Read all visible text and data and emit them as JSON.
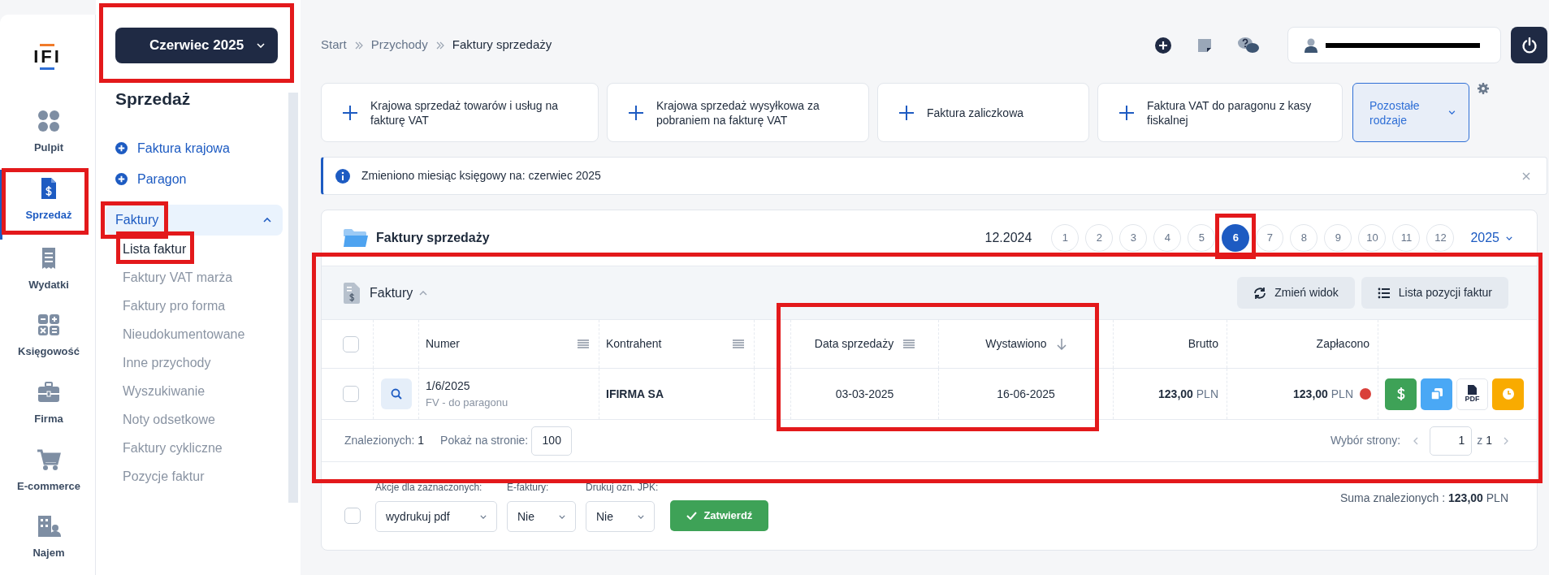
{
  "logo": {
    "text": "IFI"
  },
  "nav_rail": [
    {
      "label": "Pulpit",
      "kind": "dots",
      "selected": false,
      "highlighted": false
    },
    {
      "label": "Sprzedaż",
      "kind": "invoice",
      "selected": true,
      "highlighted": true
    },
    {
      "label": "Wydatki",
      "kind": "receipt",
      "selected": false,
      "highlighted": false
    },
    {
      "label": "Księgowość",
      "kind": "calc",
      "selected": false,
      "highlighted": false
    },
    {
      "label": "Firma",
      "kind": "briefcase",
      "selected": false,
      "highlighted": false
    },
    {
      "label": "E-commerce",
      "kind": "cart",
      "selected": false,
      "highlighted": false
    },
    {
      "label": "Najem",
      "kind": "building",
      "selected": false,
      "highlighted": false
    }
  ],
  "month_picker": {
    "label": "Czerwiec 2025",
    "highlighted": true
  },
  "sidebar": {
    "title": "Sprzedaż",
    "actions": [
      {
        "label": "Faktura krajowa"
      },
      {
        "label": "Paragon"
      }
    ],
    "group": {
      "label": "Faktury",
      "expanded": true,
      "highlighted": true,
      "children": [
        {
          "label": "Lista faktur",
          "selected": true,
          "highlighted": true
        },
        {
          "label": "Faktury VAT marża",
          "selected": false,
          "highlighted": false
        },
        {
          "label": "Faktury pro forma",
          "selected": false,
          "highlighted": false
        },
        {
          "label": "Nieudokumentowane",
          "selected": false,
          "highlighted": false
        },
        {
          "label": "Inne przychody",
          "selected": false,
          "highlighted": false
        },
        {
          "label": "Wyszukiwanie",
          "selected": false,
          "highlighted": false
        },
        {
          "label": "Noty odsetkowe",
          "selected": false,
          "highlighted": false
        },
        {
          "label": "Faktury cykliczne",
          "selected": false,
          "highlighted": false
        },
        {
          "label": "Pozycje faktur",
          "selected": false,
          "highlighted": false
        }
      ]
    }
  },
  "breadcrumb": [
    "Start",
    "Przychody",
    "Faktury sprzedaży"
  ],
  "new_doc_cards": [
    {
      "label": "Krajowa sprzedaż towarów i usług na fakturę VAT"
    },
    {
      "label": "Krajowa sprzedaż wysyłkowa za pobraniem na fakturę VAT"
    },
    {
      "label": "Faktura zaliczkowa"
    },
    {
      "label": "Faktura VAT do paragonu z kasy fiskalnej"
    }
  ],
  "more_types": {
    "label": "Pozostałe rodzaje"
  },
  "alert": {
    "text": "Zmieniono miesiąc księgowy na: czerwiec 2025"
  },
  "panel": {
    "title": "Faktury sprzedaży",
    "period": "12.2024",
    "year": "2025",
    "months": [
      {
        "label": "1",
        "selected": false,
        "highlighted": false
      },
      {
        "label": "2",
        "selected": false,
        "highlighted": false
      },
      {
        "label": "3",
        "selected": false,
        "highlighted": false
      },
      {
        "label": "4",
        "selected": false,
        "highlighted": false
      },
      {
        "label": "5",
        "selected": false,
        "highlighted": false
      },
      {
        "label": "6",
        "selected": true,
        "highlighted": true
      },
      {
        "label": "7",
        "selected": false,
        "highlighted": false
      },
      {
        "label": "8",
        "selected": false,
        "highlighted": false
      },
      {
        "label": "9",
        "selected": false,
        "highlighted": false
      },
      {
        "label": "10",
        "selected": false,
        "highlighted": false
      },
      {
        "label": "11",
        "selected": false,
        "highlighted": false
      },
      {
        "label": "12",
        "selected": false,
        "highlighted": false
      }
    ]
  },
  "invoices": {
    "title": "Faktury",
    "expanded": true,
    "highlighted": true,
    "buttons": [
      {
        "label": "Zmień widok",
        "kind": "refresh"
      },
      {
        "label": "Lista pozycji faktur",
        "kind": "list"
      }
    ],
    "select_all": {
      "checked": false
    },
    "columns": [
      {
        "label": "Numer",
        "kind": "menu",
        "highlighted": false
      },
      {
        "label": "Kontrahent",
        "kind": "menu",
        "highlighted": false
      },
      {
        "label": "Data sprzedaży",
        "kind": "menu",
        "highlighted": true
      },
      {
        "label": "Wystawiono",
        "kind": "sort",
        "highlighted": true
      },
      {
        "label": "Brutto",
        "kind": "plain",
        "highlighted": false
      },
      {
        "label": "Zapłacono",
        "kind": "plain",
        "highlighted": false
      }
    ],
    "rows": [
      {
        "checked": false,
        "number": "1/6/2025",
        "type": "FV - do paragonu",
        "contractor": "IFIRMA SA",
        "sale_date": "03-03-2025",
        "issued": "16-06-2025",
        "gross": "123,00",
        "gross_currency": "PLN",
        "paid": "123,00",
        "paid_currency": "PLN",
        "color": "#d9403a",
        "actions": [
          {
            "kind": "pay"
          },
          {
            "kind": "copy"
          },
          {
            "kind": "pdf",
            "text": "PDF"
          },
          {
            "kind": "clock"
          }
        ]
      }
    ],
    "found_label": "Znalezionych:",
    "found": "1",
    "per_page_label": "Pokaż na stronie:",
    "per_page": "100",
    "page_label": "Wybór strony:",
    "page": "1",
    "of": "z",
    "pages": "1"
  },
  "bulk": {
    "checked": false,
    "fields": [
      {
        "label": "Akcje dla zaznaczonych:",
        "value": "wydrukuj pdf"
      },
      {
        "label": "E-faktury:",
        "value": "Nie"
      },
      {
        "label": "Drukuj ozn. JPK:",
        "value": "Nie"
      }
    ],
    "submit": "Zatwierdź",
    "sum_label": "Suma znalezionych :",
    "sum_value": "123,00",
    "sum_currency": "PLN"
  }
}
